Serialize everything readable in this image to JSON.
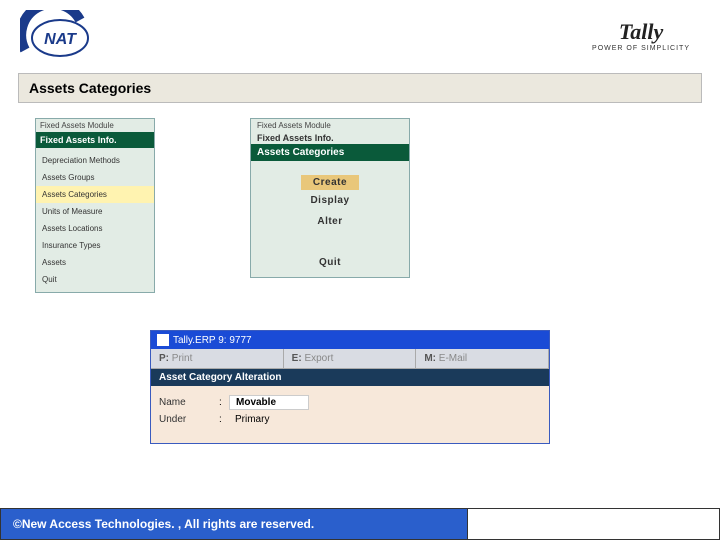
{
  "header": {
    "nat_text": "NAT",
    "tally_brand": "Tally",
    "tally_tagline": "POWER OF SIMPLICITY"
  },
  "title_bar": "Assets Categories",
  "panel_left": {
    "title1": "Fixed Assets Module",
    "title2": "Fixed Assets Info.",
    "items": [
      {
        "label": "Depreciation Methods",
        "selected": false
      },
      {
        "label": "Assets Groups",
        "selected": false
      },
      {
        "label": "Assets Categories",
        "selected": true
      },
      {
        "label": "Units of Measure",
        "selected": false
      },
      {
        "label": "Assets Locations",
        "selected": false
      },
      {
        "label": "Insurance Types",
        "selected": false
      },
      {
        "label": "Assets",
        "selected": false
      },
      {
        "label": "Quit",
        "selected": false
      }
    ]
  },
  "panel_mid": {
    "title1": "Fixed Assets Module",
    "title2": "Fixed Assets Info.",
    "title3": "Assets Categories",
    "items": [
      {
        "label": "Create",
        "selected": true
      },
      {
        "label": "Display",
        "selected": false
      },
      {
        "label": "Alter",
        "selected": false
      }
    ],
    "quit": "Quit"
  },
  "panel_bottom": {
    "window_title": "Tally.ERP 9: 9777",
    "menu": [
      {
        "key": "P:",
        "label": "Print"
      },
      {
        "key": "E:",
        "label": "Export"
      },
      {
        "key": "M:",
        "label": "E-Mail"
      }
    ],
    "section": "Asset Category Alteration",
    "rows": [
      {
        "label": "Name",
        "value": "Movable",
        "boxed": true
      },
      {
        "label": "Under",
        "value": "Primary",
        "boxed": false
      }
    ]
  },
  "footer": "©New Access Technologies. , All rights are reserved."
}
